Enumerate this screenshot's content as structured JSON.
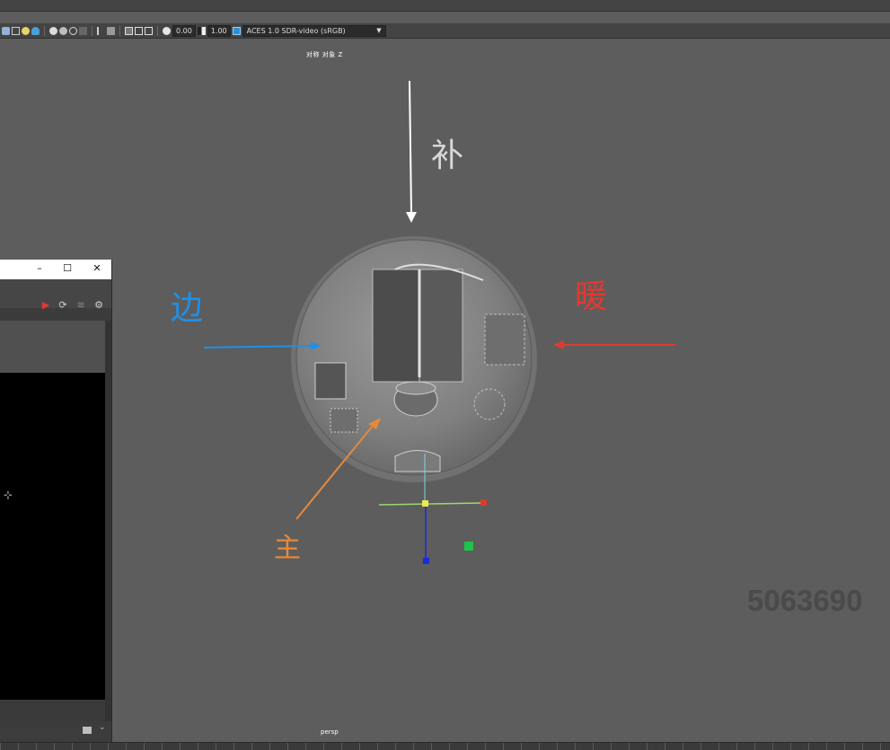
{
  "toolbar": {
    "exposure_value": "0.00",
    "gamma_value": "1.00",
    "color_space": "ACES 1.0 SDR-video (sRGB)"
  },
  "viewport": {
    "camera_title": "对称 对象 Z",
    "camera_name": "persp",
    "watermark": "5063690"
  },
  "annotations": {
    "top_label": "补",
    "left_label": "边",
    "right_label": "暖",
    "bottom_label": "主"
  },
  "colors": {
    "viewport_bg": "#5d5d5d",
    "arrow_top": "#ffffff",
    "arrow_left": "#1e90e8",
    "arrow_right": "#e03a30",
    "arrow_bottom": "#e8893a",
    "axis_x": "#e03a2a",
    "axis_y": "#1fc24a",
    "axis_z": "#1a2be0",
    "handle_center": "#f0e84a"
  },
  "window": {
    "minimize_icon": "minimize-icon",
    "maximize_icon": "maximize-icon",
    "close_icon": "close-icon"
  }
}
